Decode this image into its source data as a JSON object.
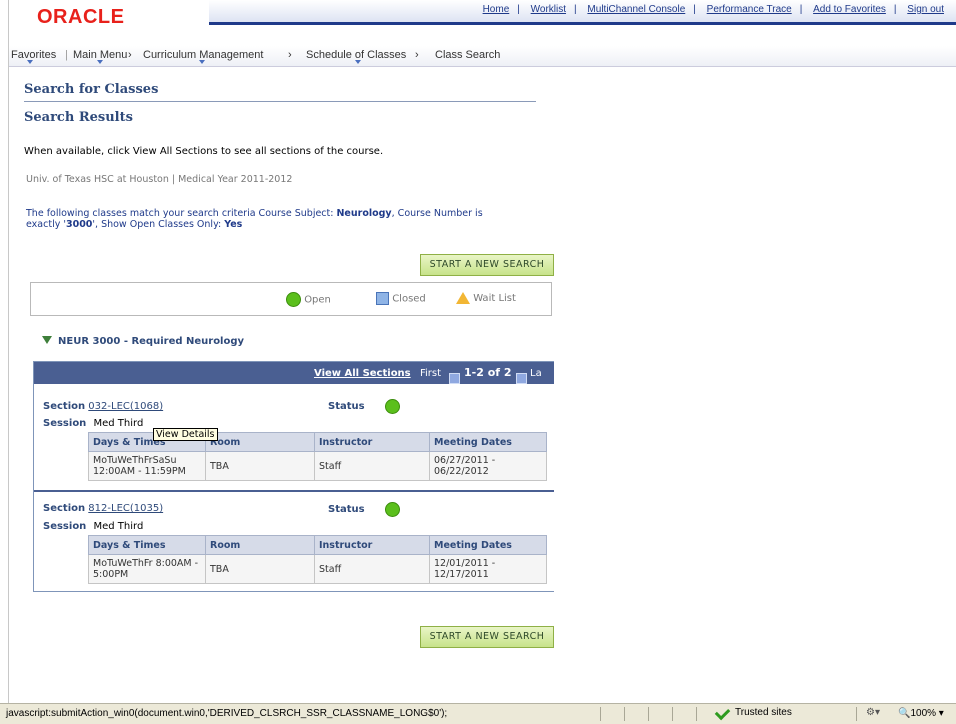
{
  "header": {
    "logo_text": "ORACLE",
    "links": [
      "Home",
      "Worklist",
      "MultiChannel Console",
      "Performance Trace",
      "Add to Favorites",
      "Sign out"
    ]
  },
  "nav": {
    "items": [
      "Favorites",
      "Main Menu",
      "Curriculum Management",
      "Schedule of Classes",
      "Class Search"
    ],
    "separator": "›"
  },
  "page": {
    "title": "Search for Classes",
    "subtitle": "Search Results",
    "instruction": "When available, click View All Sections to see all sections of the course.",
    "institution": "Univ. of Texas HSC at Houston | Medical Year 2011-2012",
    "criteria_part1": "The following classes match your search criteria Course Subject: ",
    "criteria_subject": "Neurology",
    "criteria_part2": ",  Course Number is",
    "criteria_part3": "exactly '",
    "criteria_number": "3000",
    "criteria_part4": "',  Show Open Classes Only: ",
    "criteria_open": "Yes",
    "new_search_button": "START A NEW SEARCH"
  },
  "legend": {
    "open": "Open",
    "closed": "Closed",
    "wait_list": "Wait List"
  },
  "course": {
    "title": "NEUR 3000 - Required Neurology",
    "view_all": "View All Sections",
    "first": "First",
    "range": "1-2 of 2",
    "last": "La"
  },
  "sections": [
    {
      "section_label": "Section",
      "section_link": "032-LEC(1068)",
      "status_label": "Status",
      "session_label": "Session",
      "session": "Med Third",
      "headers": [
        "Days & Times",
        "Room",
        "Instructor",
        "Meeting Dates"
      ],
      "days_times": "MoTuWeThFrSaSu 12:00AM - 11:59PM",
      "room": "TBA",
      "instructor": "Staff",
      "meeting_dates": "06/27/2011 - 06/22/2012"
    },
    {
      "section_label": "Section",
      "section_link": "812-LEC(1035)",
      "status_label": "Status",
      "session_label": "Session",
      "session": "Med Third",
      "headers": [
        "Days & Times",
        "Room",
        "Instructor",
        "Meeting Dates"
      ],
      "days_times": "MoTuWeThFr 8:00AM - 5:00PM",
      "room": "TBA",
      "instructor": "Staff",
      "meeting_dates": "12/01/2011 - 12/17/2011"
    }
  ],
  "tooltip": "View Details",
  "statusbar": {
    "url": "javascript:submitAction_win0(document.win0,'DERIVED_CLSRCH_SSR_CLASSNAME_LONG$0');",
    "zone": "Trusted sites",
    "zoom": "100%"
  },
  "colors": {
    "accent": "#2f4a7a",
    "header_band": "#4a5f92",
    "open_status": "#5bbf1c",
    "button": "#c7e38a"
  }
}
